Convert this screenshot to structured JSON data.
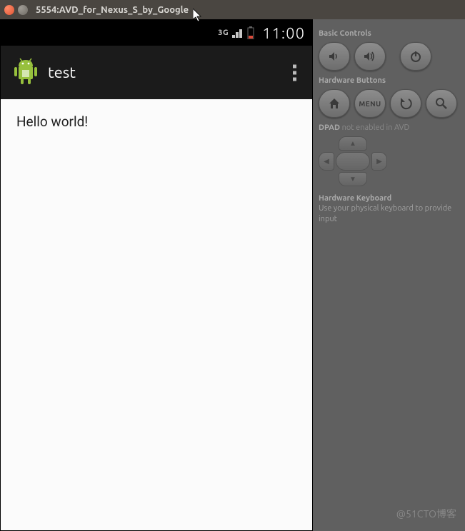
{
  "window": {
    "title": "5554:AVD_for_Nexus_S_by_Google"
  },
  "statusbar": {
    "network": "3G",
    "time": "11:00"
  },
  "app": {
    "title": "test"
  },
  "content": {
    "message": "Hello world!"
  },
  "controls": {
    "basic_label": "Basic Controls",
    "hw_label": "Hardware Buttons",
    "menu_label": "MENU",
    "dpad_label": "DPAD",
    "dpad_status": "not enabled in AVD",
    "kb_label": "Hardware Keyboard",
    "kb_hint": "Use your physical keyboard to provide input"
  },
  "watermark": "@51CTO博客"
}
